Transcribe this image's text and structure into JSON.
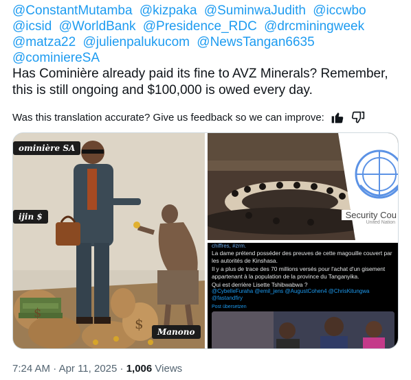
{
  "tweet": {
    "mentions": [
      "@ConstantMutamba",
      "@kizpaka",
      "@SuminwaJudith",
      "@iccwbo",
      "@icsid",
      "@WorldBank",
      "@Presidence_RDC",
      "@drcminingweek",
      "@matza22",
      "@julienpalukucom",
      "@NewsTangan6635",
      "@cominiereSA"
    ],
    "text": "Has Cominière already paid its fine to AVZ Minerals? Remember, this is still ongoing and $100,000 is owed every day.",
    "feedback_prompt": "Was this translation accurate? Give us feedback so we can improve:",
    "feedback_icons": [
      "thumbs-up-icon",
      "thumbs-down-icon"
    ],
    "time": "7:24 AM",
    "date": "Apr 11, 2025",
    "views_count": "1,006",
    "views_label": "Views"
  },
  "media": {
    "left_image": {
      "label_top": "ominière SA",
      "label_mid": "ijin $",
      "label_bottom": "Manono"
    },
    "top_right_image": {
      "security_label": "Security Cou",
      "security_sub": "United Nation"
    },
    "bottom_right_image": {
      "top_line": "chiffres, #zrm.",
      "paragraphs": [
        "La dame prétend posséder des preuves de cette magouille couvert par les autorités de Kinshasa.",
        "Il y a plus de trace des 70 millions versés pour l'achat d'un gisement appartenant à la population de la province du Tanganyika.",
        "Qui est derrière Lisette Tshibwabwa ?"
      ],
      "mentions_text": "@CybelleFuraha @emil_jens @AugustCohen4 @ChrisKitungwa @fastandfiry",
      "translate_label": "Post übersetzen"
    }
  },
  "colors": {
    "link": "#1d9bf0",
    "text": "#0f1419",
    "secondary": "#536471",
    "border": "#cfd9de"
  }
}
